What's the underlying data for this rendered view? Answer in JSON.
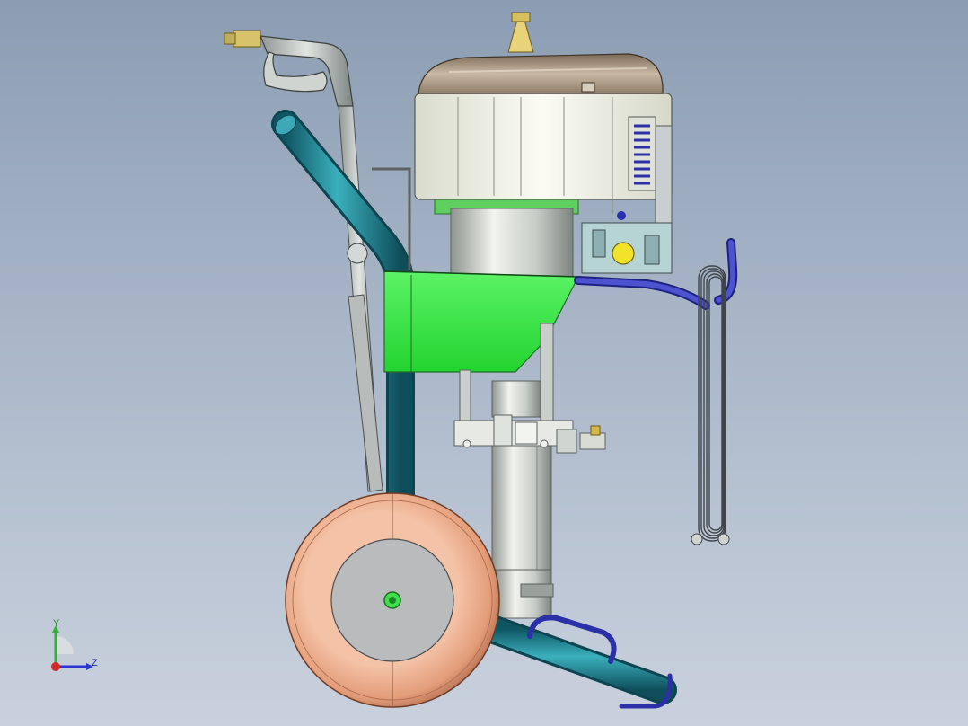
{
  "axes": {
    "y_label": "Y",
    "z_label": "Z",
    "y_color": "#33b033",
    "z_color": "#2a35d8",
    "x_color": "#d22a2a"
  },
  "colors": {
    "background_top": "#8c9db3",
    "background_bottom": "#c9d1dd",
    "frame_tube": "#1f7d8c",
    "hopper": "#2fe83c",
    "engine_cover": "#9c8a74",
    "engine_body": "#eef0e4",
    "wheel_tire": "#e8a07c",
    "wheel_hub": "#b9bbbc",
    "hose": "#3a3fb3",
    "pump": "#c9cfcb"
  },
  "icons": [
    "spray-gun-icon",
    "engine-icon",
    "hopper-icon",
    "wheel-icon",
    "hose-coil-icon",
    "coordinate-triad-icon"
  ]
}
